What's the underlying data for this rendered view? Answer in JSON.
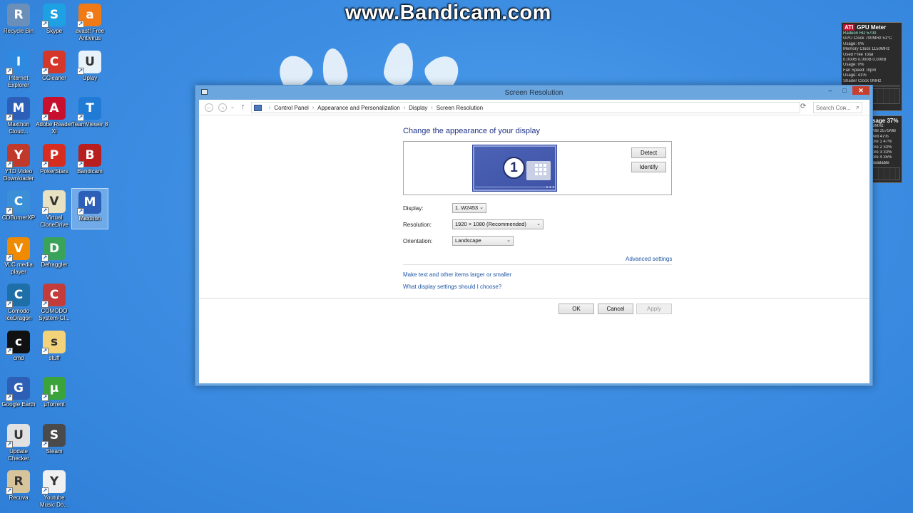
{
  "watermark": "www.Bandicam.com",
  "desktop": {
    "icons": [
      {
        "label": "Recycle Bin",
        "icon": "recycle-bin-icon",
        "color": "#6a8fb8"
      },
      {
        "label": "Skype",
        "icon": "skype-icon",
        "color": "#1da1e3"
      },
      {
        "label": "avast! Free Antivirus",
        "icon": "avast-icon",
        "color": "#f07a16"
      },
      {
        "label": "Internet Explorer",
        "icon": "internet-explorer-icon",
        "color": "#2d8ae0"
      },
      {
        "label": "CCleaner",
        "icon": "ccleaner-icon",
        "color": "#d5382b"
      },
      {
        "label": "Uplay",
        "icon": "uplay-icon",
        "color": "#e8f2fb"
      },
      {
        "label": "Maxthon Cloud...",
        "icon": "maxthon-cloud-icon",
        "color": "#2b5fb8"
      },
      {
        "label": "Adobe Reader XI",
        "icon": "adobe-reader-icon",
        "color": "#c8102e"
      },
      {
        "label": "TeamViewer 8",
        "icon": "teamviewer-icon",
        "color": "#1f7bd6"
      },
      {
        "label": "YTD Video Downloader",
        "icon": "ytd-downloader-icon",
        "color": "#c0392b"
      },
      {
        "label": "PokerStars",
        "icon": "pokerstars-icon",
        "color": "#d62d20"
      },
      {
        "label": "Bandicam",
        "icon": "bandicam-icon",
        "color": "#b81e1e"
      },
      {
        "label": "CDBurnerXP",
        "icon": "cdburnerxp-icon",
        "color": "#3a8fd6"
      },
      {
        "label": "Virtual CloneDrive",
        "icon": "virtual-clonedrive-icon",
        "color": "#e8e1c2"
      },
      {
        "label": "Maxthon",
        "icon": "maxthon-icon",
        "color": "#2b5fb8"
      },
      {
        "label": "VLC media player",
        "icon": "vlc-icon",
        "color": "#f08a00"
      },
      {
        "label": "Defraggler",
        "icon": "defraggler-icon",
        "color": "#3aa35a"
      },
      {
        "label": "Comodo IceDragon",
        "icon": "comodo-icedragon-icon",
        "color": "#1e6ea8"
      },
      {
        "label": "COMODO System-Cl...",
        "icon": "comodo-system-cleaner-icon",
        "color": "#c43b3b"
      },
      {
        "label": "cmd",
        "icon": "cmd-icon",
        "color": "#111111"
      },
      {
        "label": "stuff",
        "icon": "folder-icon",
        "color": "#f2d37a"
      },
      {
        "label": "Google Earth",
        "icon": "google-earth-icon",
        "color": "#2c5fb5"
      },
      {
        "label": "µTorrent",
        "icon": "utorrent-icon",
        "color": "#3aa33a"
      },
      {
        "label": "Update Checker",
        "icon": "update-checker-icon",
        "color": "#e1e1e1"
      },
      {
        "label": "Steam",
        "icon": "steam-icon",
        "color": "#4a4a4a"
      },
      {
        "label": "Recuva",
        "icon": "recuva-icon",
        "color": "#d8c49a"
      },
      {
        "label": "Youtube Music Do...",
        "icon": "youtube-music-icon",
        "color": "#f0f0f0"
      }
    ]
  },
  "gpu_meter": {
    "brand": "ATI",
    "title": "GPU Meter",
    "subtitle": "Radeon HD 5700",
    "rows": [
      "GPU Clock 700MHz      51°C",
      "Usage: 0%",
      "Memory Clock 1150MHz",
      "  Used     Free     Total",
      "0.000B  0.000B   0.000B",
      "Usage: 0%",
      "Fan Speed: 0rpm",
      "Usage: 41%",
      "Shader Clock 0MHz"
    ],
    "usage_fill": 0.41
  },
  "cpu_meter": {
    "title": "sage 37%",
    "rows": [
      "3MHz",
      "MB   3575MB",
      "AM      47%",
      "ore 1   47%",
      "ore 2   33%",
      "ore 3   33%",
      "ore 4   35%",
      "available"
    ]
  },
  "window": {
    "title": "Screen Resolution",
    "min_label": "–",
    "max_label": "□",
    "close_label": "✕",
    "nav": {
      "back": "←",
      "forward": "→",
      "dropdown": "⌄",
      "up": "↑",
      "refresh": "⟳"
    },
    "breadcrumb": [
      "Control Panel",
      "Appearance and Personalization",
      "Display",
      "Screen Resolution"
    ],
    "breadcrumb_sep": "›",
    "search_placeholder": "Search Con...",
    "search_icon": "⌕",
    "heading": "Change the appearance of your display",
    "monitor_number": "1",
    "detect_label": "Detect",
    "identify_label": "Identify",
    "display_label": "Display:",
    "display_value": "1. W2453",
    "resolution_label": "Resolution:",
    "resolution_value": "1920 × 1080 (Recommended)",
    "orientation_label": "Orientation:",
    "orientation_value": "Landscape",
    "advanced_settings": "Advanced settings",
    "link_text_size": "Make text and other items larger or smaller",
    "link_display_settings": "What display settings should I choose?",
    "ok_label": "OK",
    "cancel_label": "Cancel",
    "apply_label": "Apply"
  }
}
